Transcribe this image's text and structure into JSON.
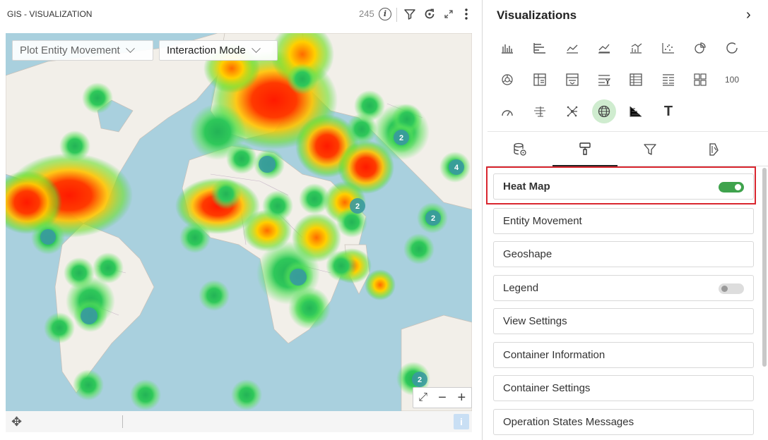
{
  "left_panel": {
    "title": "GIS - VISUALIZATION",
    "count": "245",
    "icons": [
      "info-icon",
      "filter-icon",
      "refresh-icon",
      "expand-icon",
      "more-icon"
    ],
    "dropdowns": [
      {
        "label": "Plot Entity Movement"
      },
      {
        "label": "Interaction Mode"
      }
    ],
    "zoom_controls": {
      "fit": "⤢",
      "minus": "−",
      "plus": "+"
    },
    "cluster_labels": [
      "2",
      "2",
      "2",
      "4",
      "2"
    ],
    "footer": {
      "info": "i"
    }
  },
  "right_panel": {
    "title": "Visualizations",
    "chevron": "›",
    "viz_icons": [
      "bar-chart-icon",
      "horizontal-bar-icon",
      "line-chart-icon",
      "area-chart-icon",
      "combo-chart-icon",
      "scatter-icon",
      "pie-chart-icon",
      "donut-icon",
      "sunburst-icon",
      "pivot-icon",
      "table-expand-icon",
      "table-filter-icon",
      "table-icon",
      "list-icon",
      "tiles-icon",
      "kpi-number-icon",
      "gauge-icon",
      "bullet-icon",
      "network-icon",
      "globe-icon",
      "step-chart-icon",
      "text-icon"
    ],
    "kpi_label": "100",
    "text_label": "T",
    "tabs": [
      "database-settings-tab",
      "format-tab",
      "filter-tab",
      "theme-tab"
    ],
    "items": [
      {
        "label": "Heat Map",
        "toggle": "on"
      },
      {
        "label": "Entity Movement"
      },
      {
        "label": "Geoshape"
      },
      {
        "label": "Legend",
        "toggle": "off"
      },
      {
        "label": "View Settings"
      },
      {
        "label": "Container Information"
      },
      {
        "label": "Container Settings"
      },
      {
        "label": "Operation States Messages"
      }
    ]
  }
}
